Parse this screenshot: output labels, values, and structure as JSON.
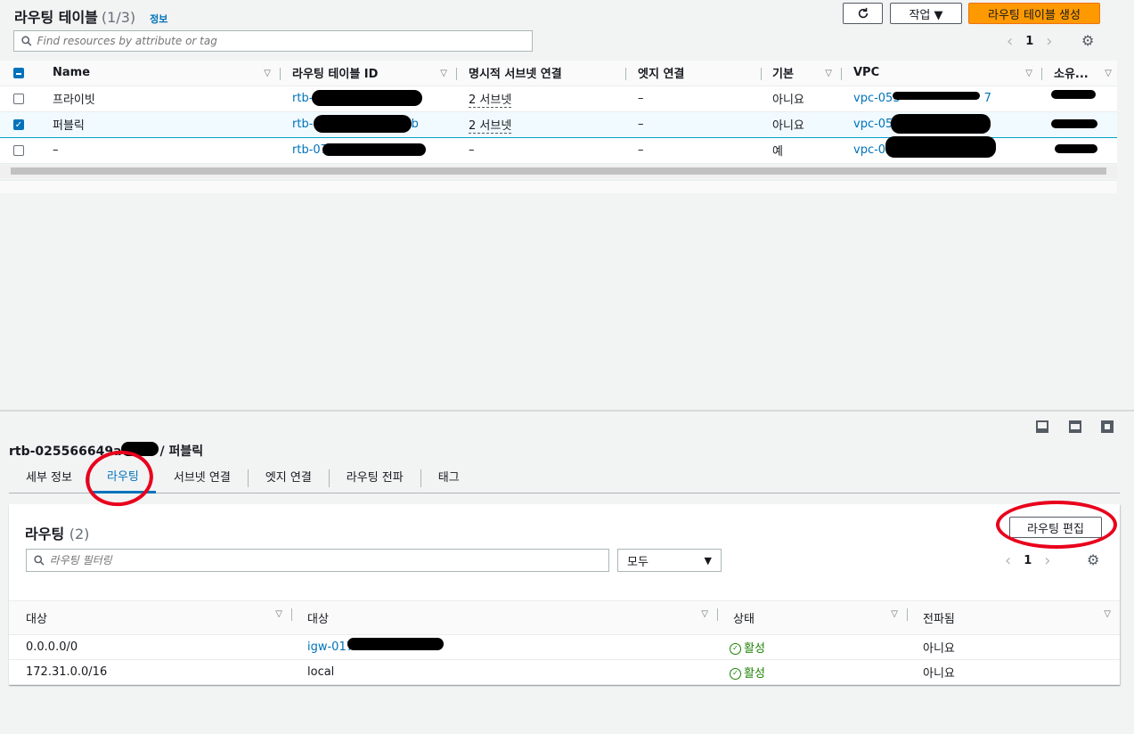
{
  "top": {
    "title": "라우팅 테이블",
    "count": "(1/3)",
    "info": "정보",
    "refresh_icon": "refresh-icon",
    "actions_label": "작업 ▼",
    "create_label": "라우팅 테이블 생성",
    "search_placeholder": "Find resources by attribute or tag",
    "page": "1",
    "columns": [
      "Name",
      "라우팅 테이블 ID",
      "명시적 서브넷 연결",
      "엣지 연결",
      "기본",
      "VPC",
      "소유..."
    ],
    "rows": [
      {
        "name": "프라이빗",
        "id": "rtb-0",
        "subnets": "2 서브넷",
        "edge": "–",
        "main": "아니요",
        "vpc": "vpc-053",
        "vpc_tail": "7",
        "selected": false
      },
      {
        "name": "퍼블릭",
        "id": "rtb-0",
        "id_tail": "b",
        "subnets": "2 서브넷",
        "edge": "–",
        "main": "아니요",
        "vpc": "vpc-05",
        "selected": true
      },
      {
        "name": "–",
        "id": "rtb-07",
        "subnets": "–",
        "edge": "–",
        "main": "예",
        "vpc": "vpc-05",
        "selected": false
      }
    ]
  },
  "detail": {
    "title": "rtb-025566649a",
    "title_tail": "fb / 퍼블릭",
    "tabs": [
      "세부 정보",
      "라우팅",
      "서브넷 연결",
      "엣지 연결",
      "라우팅 전파",
      "태그"
    ],
    "active_tab": 1,
    "routes_title": "라우팅",
    "routes_count": "(2)",
    "edit_label": "라우팅 편집",
    "filter_placeholder": "라우팅 필터링",
    "select_value": "모두",
    "page": "1",
    "columns": [
      "대상",
      "대상",
      "상태",
      "전파됨"
    ],
    "rows": [
      {
        "dest": "0.0.0.0/0",
        "target": "igw-017",
        "target_link": true,
        "status": "활성",
        "propagated": "아니요"
      },
      {
        "dest": "172.31.0.0/16",
        "target": "local",
        "target_link": false,
        "status": "활성",
        "propagated": "아니요"
      }
    ]
  },
  "colors": {
    "accent": "#0073bb",
    "primary": "#ff9900",
    "success": "#1d8102",
    "annotation": "#e8001c"
  }
}
